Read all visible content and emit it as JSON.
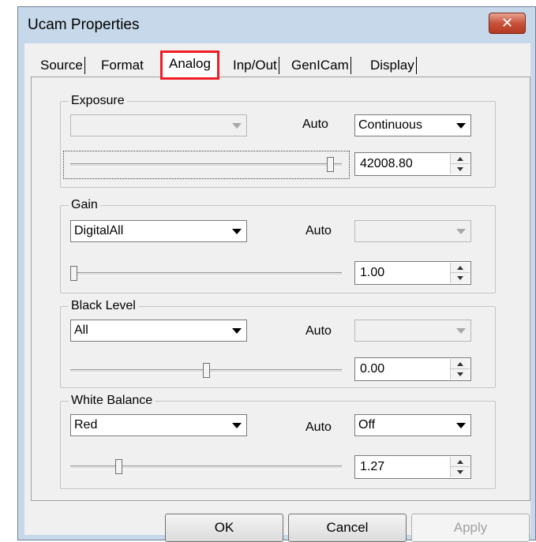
{
  "window": {
    "title": "Ucam Properties",
    "close_glyph": "✕"
  },
  "tabs": [
    {
      "label": "Source"
    },
    {
      "label": "Format"
    },
    {
      "label": "Analog",
      "active": true
    },
    {
      "label": "Inp/Out"
    },
    {
      "label": "GenICam"
    },
    {
      "label": "Display"
    }
  ],
  "groups": {
    "exposure": {
      "label": "Exposure",
      "mode_select": {
        "value": "",
        "enabled": false
      },
      "auto_label": "Auto",
      "auto_select": {
        "value": "Continuous",
        "enabled": true
      },
      "slider_level": 0.97,
      "spin_value": "42008.80"
    },
    "gain": {
      "label": "Gain",
      "mode_select": {
        "value": "DigitalAll",
        "enabled": true
      },
      "auto_label": "Auto",
      "auto_select": {
        "value": "",
        "enabled": false
      },
      "slider_level": 0.0,
      "spin_value": "1.00"
    },
    "black_level": {
      "label": "Black Level",
      "mode_select": {
        "value": "All",
        "enabled": true
      },
      "auto_label": "Auto",
      "auto_select": {
        "value": "",
        "enabled": false
      },
      "slider_level": 0.5,
      "spin_value": "0.00"
    },
    "white_balance": {
      "label": "White Balance",
      "mode_select": {
        "value": "Red",
        "enabled": true
      },
      "auto_label": "Auto",
      "auto_select": {
        "value": "Off",
        "enabled": true
      },
      "slider_level": 0.17,
      "spin_value": "1.27"
    }
  },
  "buttons": {
    "ok": "OK",
    "cancel": "Cancel",
    "apply": "Apply"
  },
  "colors": {
    "highlight": "#ef1c24",
    "titlebar": "#c6d8ea",
    "close_button": "#c8523b"
  }
}
